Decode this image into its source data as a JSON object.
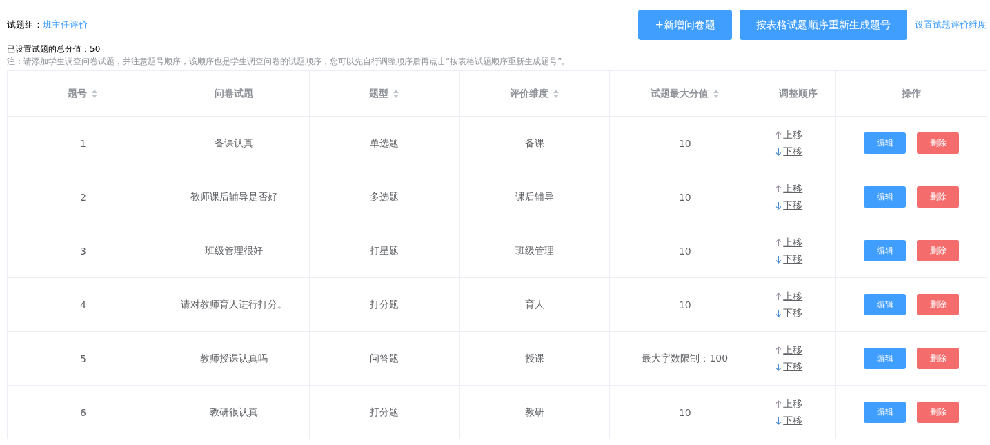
{
  "group": {
    "label": "试题组：",
    "value": "班主任评价"
  },
  "buttons": [
    {
      "label": "+新增问卷题",
      "kind": "primary"
    },
    {
      "label": "按表格试题顺序重新生成题号",
      "kind": "primary"
    }
  ],
  "settings_link": "设置试题评价维度",
  "total": "已设置试题的总分值：50",
  "note": "注：请添加学生调查问卷试题，并注意题号顺序，该顺序也是学生调查问卷的试题顺序，您可以先自行调整顺序后再点击“按表格试题顺序重新生成题号”。",
  "table": {
    "columns": [
      {
        "label": "题号",
        "sortable": true
      },
      {
        "label": "问卷试题",
        "sortable": false
      },
      {
        "label": "题型",
        "sortable": true
      },
      {
        "label": "评价维度",
        "sortable": true
      },
      {
        "label": "试题最大分值",
        "sortable": true
      },
      {
        "label": "调整顺序",
        "sortable": false
      },
      {
        "label": "操作",
        "sortable": false
      }
    ],
    "rows": [
      {
        "cells": [
          "1",
          "备课认真",
          "单选题",
          "备课",
          "10"
        ],
        "move_up": "上移",
        "move_down": "下移",
        "edit": "编辑",
        "delete": "删除"
      },
      {
        "cells": [
          "2",
          "教师课后辅导是否好",
          "多选题",
          "课后辅导",
          "10"
        ],
        "move_up": "上移",
        "move_down": "下移",
        "edit": "编辑",
        "delete": "删除"
      },
      {
        "cells": [
          "3",
          "班级管理很好",
          "打星题",
          "班级管理",
          "10"
        ],
        "move_up": "上移",
        "move_down": "下移",
        "edit": "编辑",
        "delete": "删除"
      },
      {
        "cells": [
          "4",
          "请对教师育人进行打分。",
          "打分题",
          "育人",
          "10"
        ],
        "move_up": "上移",
        "move_down": "下移",
        "edit": "编辑",
        "delete": "删除"
      },
      {
        "cells": [
          "5",
          "教师授课认真吗",
          "问答题",
          "授课",
          "最大字数限制：100"
        ],
        "move_up": "上移",
        "move_down": "下移",
        "edit": "编辑",
        "delete": "删除"
      },
      {
        "cells": [
          "6",
          "教研很认真",
          "打分题",
          "教研",
          "10"
        ],
        "move_up": "上移",
        "move_down": "下移",
        "edit": "编辑",
        "delete": "删除"
      }
    ]
  }
}
